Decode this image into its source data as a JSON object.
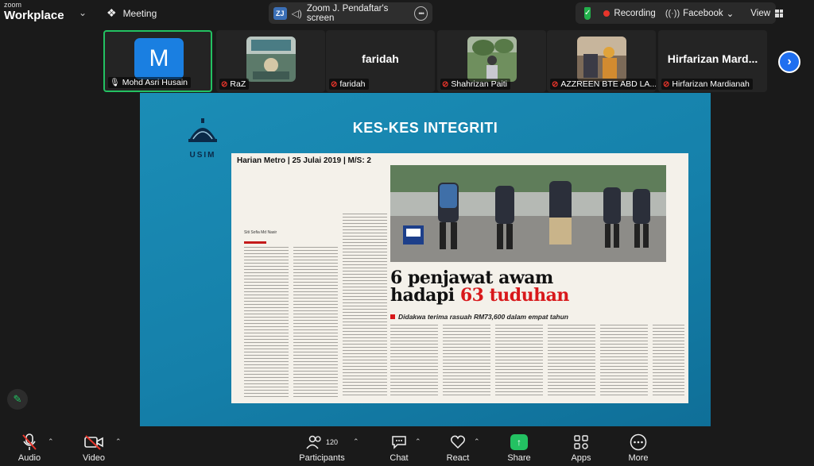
{
  "brand": {
    "zoom": "zoom",
    "workplace": "Workplace"
  },
  "meeting": {
    "label": "Meeting"
  },
  "share_pill": {
    "initials": "ZJ",
    "label": "Zoom J. Pendaftar's screen"
  },
  "status": {
    "recording": "Recording",
    "facebook": "Facebook",
    "view": "View"
  },
  "participants": [
    {
      "name": "Mohd Asri Husain",
      "avatar_letter": "M",
      "muted": false
    },
    {
      "name": "RaZ",
      "muted": true
    },
    {
      "name": "faridah",
      "display": "faridah",
      "muted": true
    },
    {
      "name": "Shahrizan Paiti",
      "muted": true
    },
    {
      "name": "AZZREEN BTE ABD LA...",
      "muted": true
    },
    {
      "name": "Hirfarizan Mardianah",
      "display": "Hirfarizan Mard...",
      "muted": true
    }
  ],
  "slide": {
    "title": "KES-KES INTEGRITI",
    "logo_text": "USIM",
    "paper_head": "Harian Metro | 25 Julai 2019 | M/S: 2",
    "headline_line1": "6 penjawat awam",
    "headline_line2_a": "hadapi",
    "headline_line2_b": "63 tuduhan",
    "subheadline": "Didakwa terima rasuah RM73,600 dalam empat tahun",
    "byline": "Siti Sofia Md Nasir"
  },
  "toolbar": {
    "audio": "Audio",
    "video": "Video",
    "participants": "Participants",
    "participants_count": "120",
    "chat": "Chat",
    "react": "React",
    "share": "Share",
    "apps": "Apps",
    "more": "More"
  },
  "colors": {
    "accent_green": "#23c162",
    "accent_blue": "#1f6ff0",
    "record_red": "#e8352b",
    "headline_red": "#d8181b"
  }
}
